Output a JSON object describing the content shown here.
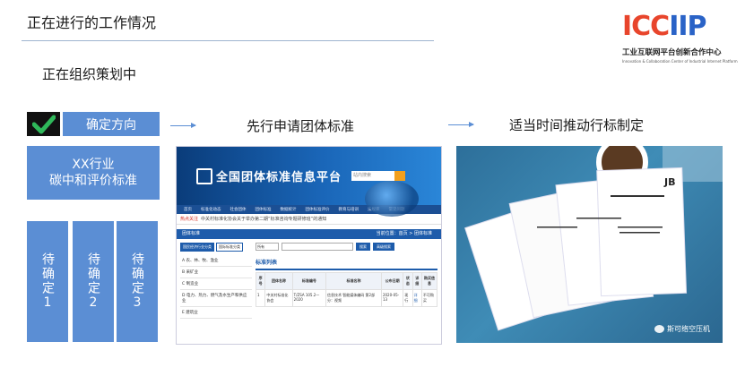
{
  "title": "正在进行的工作情况",
  "logo": {
    "mark_red": "ICC",
    "mark_blue": "IIP",
    "cn": "工业互联网平台创新合作中心",
    "en": "Innovation & Collaboration Center of Industrial Internet Platform"
  },
  "subtitle": "正在组织策划中",
  "steps": {
    "direction": "确定方向",
    "industry_line1": "XX行业",
    "industry_line2": "碳中和评价标准",
    "pending": [
      "待确定1",
      "待确定2",
      "待确定3"
    ]
  },
  "labels": {
    "group_standard": "先行申请团体标准",
    "industry_standard": "适当时间推动行标制定"
  },
  "website": {
    "title": "全国团体标准信息平台",
    "search_placeholder": "站内搜索",
    "nav": [
      "首页",
      "标准化动态",
      "社会团体",
      "团体标准",
      "数据统计",
      "团体标准评价",
      "教育与培训",
      "法规库",
      "常见问题"
    ],
    "ticker_hot": "热点关注",
    "ticker_text": "中关村标准化协会关于举办第二期“标准咨询专题研修班”的通知",
    "section": "团体标准",
    "breadcrumb": "当前位置：首页 > 团体标准",
    "cat_tabs": [
      "国民经济行业分类",
      "国际标准分类"
    ],
    "categories": [
      "A 农、林、牧、渔业",
      "B 采矿业",
      "C 制造业",
      "D 电力、热力、燃气及水生产和供应业",
      "E 建筑业"
    ],
    "filter_select": "所有",
    "filter_btn1": "搜索",
    "filter_btn2": "高级搜索",
    "list_title": "标准列表",
    "columns": [
      "序号",
      "团体名称",
      "标准编号",
      "标准名称",
      "公布日期",
      "状态",
      "详细",
      "购买信息"
    ],
    "rows": [
      [
        "1",
        "中关村标准化协会",
        "T/ZSA 105.2—2020",
        "信息技术 智能媒体编码 第2部分：视频",
        "2020-05-13",
        "现行",
        "详细",
        "不可购买"
      ]
    ]
  },
  "photo": {
    "doc_mark": "JB",
    "watermark": "斯可络空压机"
  }
}
